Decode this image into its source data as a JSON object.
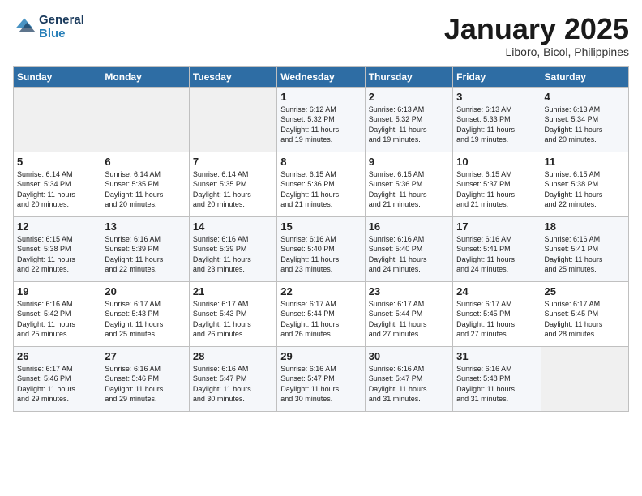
{
  "header": {
    "logo_line1": "General",
    "logo_line2": "Blue",
    "month": "January 2025",
    "location": "Liboro, Bicol, Philippines"
  },
  "days_of_week": [
    "Sunday",
    "Monday",
    "Tuesday",
    "Wednesday",
    "Thursday",
    "Friday",
    "Saturday"
  ],
  "weeks": [
    [
      {
        "day": "",
        "info": ""
      },
      {
        "day": "",
        "info": ""
      },
      {
        "day": "",
        "info": ""
      },
      {
        "day": "1",
        "info": "Sunrise: 6:12 AM\nSunset: 5:32 PM\nDaylight: 11 hours\nand 19 minutes."
      },
      {
        "day": "2",
        "info": "Sunrise: 6:13 AM\nSunset: 5:32 PM\nDaylight: 11 hours\nand 19 minutes."
      },
      {
        "day": "3",
        "info": "Sunrise: 6:13 AM\nSunset: 5:33 PM\nDaylight: 11 hours\nand 19 minutes."
      },
      {
        "day": "4",
        "info": "Sunrise: 6:13 AM\nSunset: 5:34 PM\nDaylight: 11 hours\nand 20 minutes."
      }
    ],
    [
      {
        "day": "5",
        "info": "Sunrise: 6:14 AM\nSunset: 5:34 PM\nDaylight: 11 hours\nand 20 minutes."
      },
      {
        "day": "6",
        "info": "Sunrise: 6:14 AM\nSunset: 5:35 PM\nDaylight: 11 hours\nand 20 minutes."
      },
      {
        "day": "7",
        "info": "Sunrise: 6:14 AM\nSunset: 5:35 PM\nDaylight: 11 hours\nand 20 minutes."
      },
      {
        "day": "8",
        "info": "Sunrise: 6:15 AM\nSunset: 5:36 PM\nDaylight: 11 hours\nand 21 minutes."
      },
      {
        "day": "9",
        "info": "Sunrise: 6:15 AM\nSunset: 5:36 PM\nDaylight: 11 hours\nand 21 minutes."
      },
      {
        "day": "10",
        "info": "Sunrise: 6:15 AM\nSunset: 5:37 PM\nDaylight: 11 hours\nand 21 minutes."
      },
      {
        "day": "11",
        "info": "Sunrise: 6:15 AM\nSunset: 5:38 PM\nDaylight: 11 hours\nand 22 minutes."
      }
    ],
    [
      {
        "day": "12",
        "info": "Sunrise: 6:15 AM\nSunset: 5:38 PM\nDaylight: 11 hours\nand 22 minutes."
      },
      {
        "day": "13",
        "info": "Sunrise: 6:16 AM\nSunset: 5:39 PM\nDaylight: 11 hours\nand 22 minutes."
      },
      {
        "day": "14",
        "info": "Sunrise: 6:16 AM\nSunset: 5:39 PM\nDaylight: 11 hours\nand 23 minutes."
      },
      {
        "day": "15",
        "info": "Sunrise: 6:16 AM\nSunset: 5:40 PM\nDaylight: 11 hours\nand 23 minutes."
      },
      {
        "day": "16",
        "info": "Sunrise: 6:16 AM\nSunset: 5:40 PM\nDaylight: 11 hours\nand 24 minutes."
      },
      {
        "day": "17",
        "info": "Sunrise: 6:16 AM\nSunset: 5:41 PM\nDaylight: 11 hours\nand 24 minutes."
      },
      {
        "day": "18",
        "info": "Sunrise: 6:16 AM\nSunset: 5:41 PM\nDaylight: 11 hours\nand 25 minutes."
      }
    ],
    [
      {
        "day": "19",
        "info": "Sunrise: 6:16 AM\nSunset: 5:42 PM\nDaylight: 11 hours\nand 25 minutes."
      },
      {
        "day": "20",
        "info": "Sunrise: 6:17 AM\nSunset: 5:43 PM\nDaylight: 11 hours\nand 25 minutes."
      },
      {
        "day": "21",
        "info": "Sunrise: 6:17 AM\nSunset: 5:43 PM\nDaylight: 11 hours\nand 26 minutes."
      },
      {
        "day": "22",
        "info": "Sunrise: 6:17 AM\nSunset: 5:44 PM\nDaylight: 11 hours\nand 26 minutes."
      },
      {
        "day": "23",
        "info": "Sunrise: 6:17 AM\nSunset: 5:44 PM\nDaylight: 11 hours\nand 27 minutes."
      },
      {
        "day": "24",
        "info": "Sunrise: 6:17 AM\nSunset: 5:45 PM\nDaylight: 11 hours\nand 27 minutes."
      },
      {
        "day": "25",
        "info": "Sunrise: 6:17 AM\nSunset: 5:45 PM\nDaylight: 11 hours\nand 28 minutes."
      }
    ],
    [
      {
        "day": "26",
        "info": "Sunrise: 6:17 AM\nSunset: 5:46 PM\nDaylight: 11 hours\nand 29 minutes."
      },
      {
        "day": "27",
        "info": "Sunrise: 6:16 AM\nSunset: 5:46 PM\nDaylight: 11 hours\nand 29 minutes."
      },
      {
        "day": "28",
        "info": "Sunrise: 6:16 AM\nSunset: 5:47 PM\nDaylight: 11 hours\nand 30 minutes."
      },
      {
        "day": "29",
        "info": "Sunrise: 6:16 AM\nSunset: 5:47 PM\nDaylight: 11 hours\nand 30 minutes."
      },
      {
        "day": "30",
        "info": "Sunrise: 6:16 AM\nSunset: 5:47 PM\nDaylight: 11 hours\nand 31 minutes."
      },
      {
        "day": "31",
        "info": "Sunrise: 6:16 AM\nSunset: 5:48 PM\nDaylight: 11 hours\nand 31 minutes."
      },
      {
        "day": "",
        "info": ""
      }
    ]
  ]
}
